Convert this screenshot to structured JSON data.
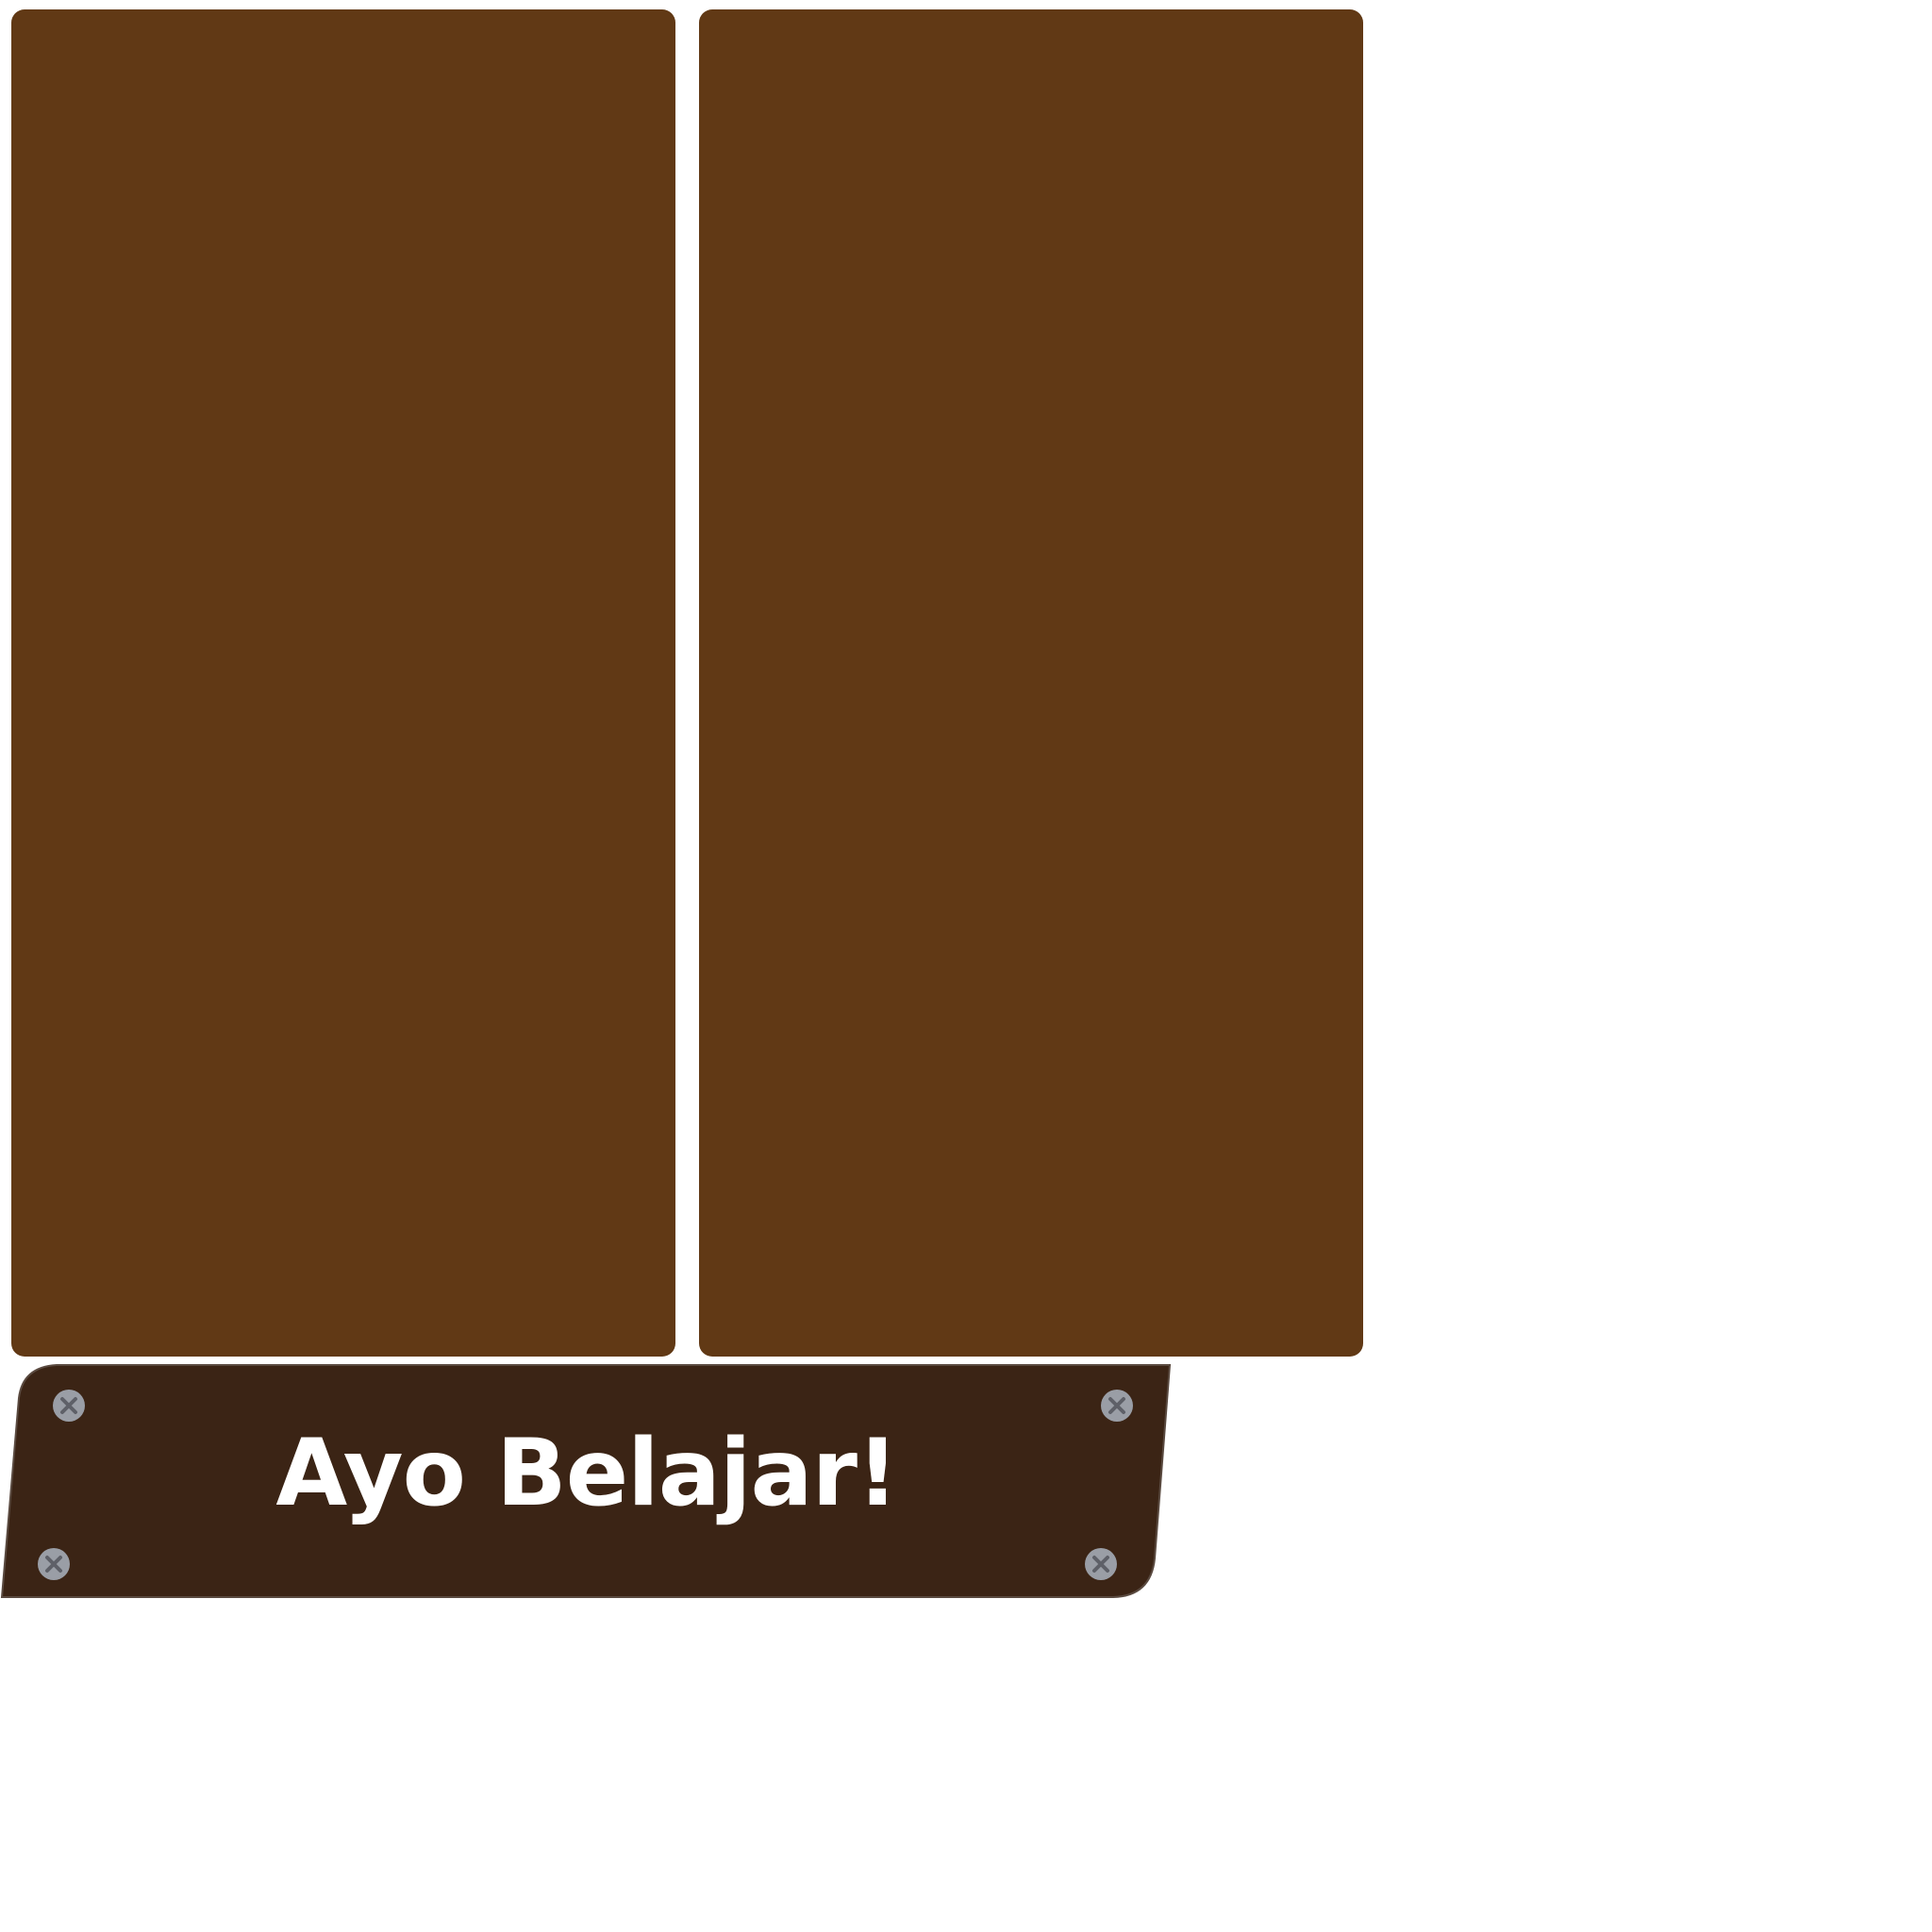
{
  "colors": {
    "background": "#ffffff",
    "panel": "#613915",
    "sign": "#3b2415",
    "sign_edge": "#5a4a40",
    "sign_text": "#ffffff",
    "screw": "#9a9ea6",
    "screw_cross": "#5e6068"
  },
  "panels": [
    {
      "name": "left-panel"
    },
    {
      "name": "right-panel"
    }
  ],
  "sign": {
    "title": "Ayo Belajar!",
    "screw_icon": "screw-icon"
  }
}
